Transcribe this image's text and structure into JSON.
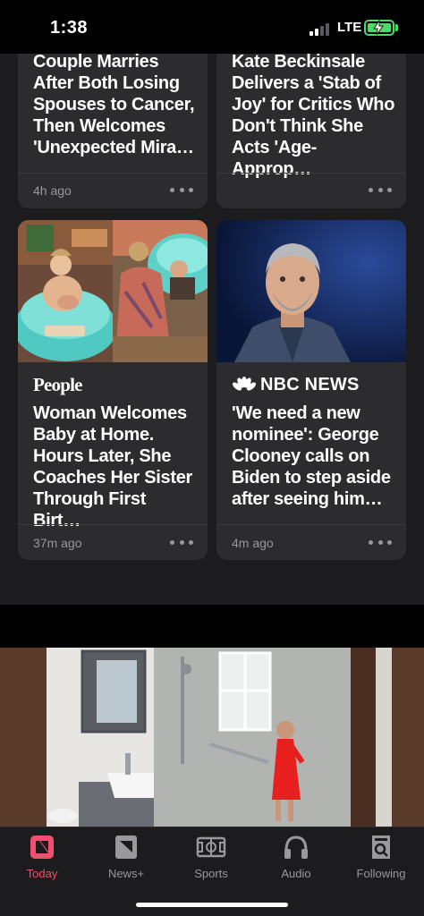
{
  "status_bar": {
    "time": "1:38",
    "network": "LTE",
    "signal_bars": 2,
    "battery_level": 0.8,
    "charging": true
  },
  "feed": {
    "cards_top": [
      {
        "headline": "Couple Marries After Both Losing Spouses to Cancer, Then Welcomes 'Unexpected Mira…",
        "time": "4h ago"
      },
      {
        "headline": "Kate Beckinsale Delivers a 'Stab of Joy' for Critics Who Don't Think She Acts 'Age-Approp…",
        "time": ""
      }
    ],
    "cards_bottom": [
      {
        "publisher": "People",
        "headline": "Woman Welcomes Baby at Home. Hours Later, She Coaches Her Sister Through First Birt…",
        "time": "37m ago"
      },
      {
        "publisher": "NBC NEWS",
        "headline": "'We need a new nominee': George Clooney calls on Biden to step aside after seeing him…",
        "time": "4m ago"
      }
    ]
  },
  "tab_bar": {
    "tabs": [
      {
        "label": "Today",
        "icon": "news-icon",
        "active": true
      },
      {
        "label": "News+",
        "icon": "news-plus-icon",
        "active": false
      },
      {
        "label": "Sports",
        "icon": "sports-icon",
        "active": false
      },
      {
        "label": "Audio",
        "icon": "headphones-icon",
        "active": false
      },
      {
        "label": "Following",
        "icon": "following-icon",
        "active": false
      }
    ]
  },
  "colors": {
    "accent": "#f0506e",
    "background": "#1c1c1e",
    "card": "#2c2c2e",
    "secondary_text": "#98989d"
  }
}
